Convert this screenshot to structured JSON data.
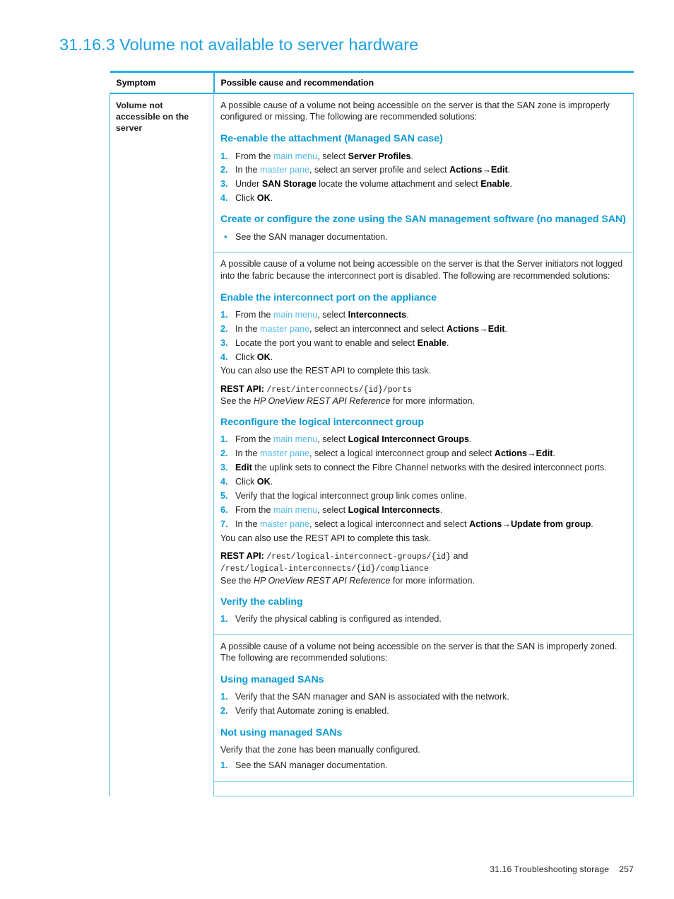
{
  "section": {
    "number": "31.16.3",
    "title": "Volume not available to server hardware"
  },
  "table": {
    "headers": {
      "col1": "Symptom",
      "col2": "Possible cause and recommendation"
    },
    "symptom": "Volume not accessible on the server",
    "rows": [
      {
        "intro": "A possible cause of a volume not being accessible on the server is that the SAN zone is improperly configured or missing. The following are recommended solutions:",
        "blocks": [
          {
            "heading": "Re-enable the attachment (Managed SAN case)",
            "list_type": "ordered",
            "items": [
              {
                "n": "1.",
                "text": "From the main menu, select Server Profiles."
              },
              {
                "n": "2.",
                "text": "In the master pane, select an server profile and select Actions→Edit."
              },
              {
                "n": "3.",
                "text": "Under SAN Storage locate the volume attachment and select Enable."
              },
              {
                "n": "4.",
                "text": "Click OK."
              }
            ]
          },
          {
            "heading": "Create or configure the zone using the SAN management software (no managed SAN)",
            "list_type": "bulleted",
            "items": [
              {
                "n": "•",
                "text": "See the SAN manager documentation."
              }
            ]
          }
        ]
      },
      {
        "intro": "A possible cause of a volume not being accessible on the server is that the Server initiators not logged into the fabric because the interconnect port is disabled. The following are recommended solutions:",
        "blocks": [
          {
            "heading": "Enable the interconnect port on the appliance",
            "list_type": "ordered",
            "items": [
              {
                "n": "1.",
                "text": "From the main menu, select Interconnects."
              },
              {
                "n": "2.",
                "text": "In the master pane, select an interconnect and select Actions→Edit."
              },
              {
                "n": "3.",
                "text": "Locate the port you want to enable and select Enable."
              },
              {
                "n": "4.",
                "text": "Click OK."
              }
            ],
            "after_note": "You can also use the REST API to complete this task.",
            "api_label": "REST API:",
            "api_paths": [
              "/rest/interconnects/{id}/ports"
            ],
            "see_prefix": "See the ",
            "see_ref": "HP OneView REST API Reference",
            "see_suffix": " for more information."
          },
          {
            "heading": "Reconfigure the logical interconnect group",
            "list_type": "ordered",
            "items": [
              {
                "n": "1.",
                "text": "From the main menu, select Logical Interconnect Groups."
              },
              {
                "n": "2.",
                "text": "In the master pane, select a logical interconnect group and select Actions→Edit."
              },
              {
                "n": "3.",
                "text": "Edit the uplink sets to connect the Fibre Channel networks with the desired interconnect ports."
              },
              {
                "n": "4.",
                "text": "Click OK."
              },
              {
                "n": "5.",
                "text": "Verify that the logical interconnect group link comes online."
              },
              {
                "n": "6.",
                "text": "From the main menu, select Logical Interconnects."
              },
              {
                "n": "7.",
                "text": "In the master pane, select a logical interconnect and select Actions→Update from group."
              }
            ],
            "after_note": "You can also use the REST API to complete this task.",
            "api_label": "REST API:",
            "api_paths": [
              "/rest/logical-interconnect-groups/{id}",
              "/rest/logical-interconnects/{id}/compliance"
            ],
            "api_conjunction": "and",
            "see_prefix": "See the ",
            "see_ref": "HP OneView REST API Reference",
            "see_suffix": " for more information."
          },
          {
            "heading": "Verify the cabling",
            "list_type": "ordered",
            "items": [
              {
                "n": "1.",
                "text": "Verify the physical cabling is configured as intended."
              }
            ]
          }
        ]
      },
      {
        "intro": "A possible cause of a volume not being accessible on the server is that the SAN is improperly zoned. The following are recommended solutions:",
        "blocks": [
          {
            "heading": "Using managed SANs",
            "list_type": "ordered",
            "items": [
              {
                "n": "1.",
                "text": "Verify that the SAN manager and SAN is associated with the network."
              },
              {
                "n": "2.",
                "text": "Verify that Automate zoning is enabled."
              }
            ]
          },
          {
            "heading": "Not using managed SANs",
            "pre_list_text": "Verify that the zone has been manually configured.",
            "list_type": "ordered",
            "items": [
              {
                "n": "1.",
                "text": "See the SAN manager documentation."
              }
            ]
          }
        ]
      }
    ]
  },
  "footer": {
    "running_head": "31.16 Troubleshooting storage",
    "page_number": "257"
  },
  "colors": {
    "heading_blue": "#1ba1e2",
    "subhead_blue": "#0b9ad4",
    "link_blue": "#52b9e9",
    "rule_blue": "#29abe2",
    "hairline_blue": "#6ec7ea"
  }
}
